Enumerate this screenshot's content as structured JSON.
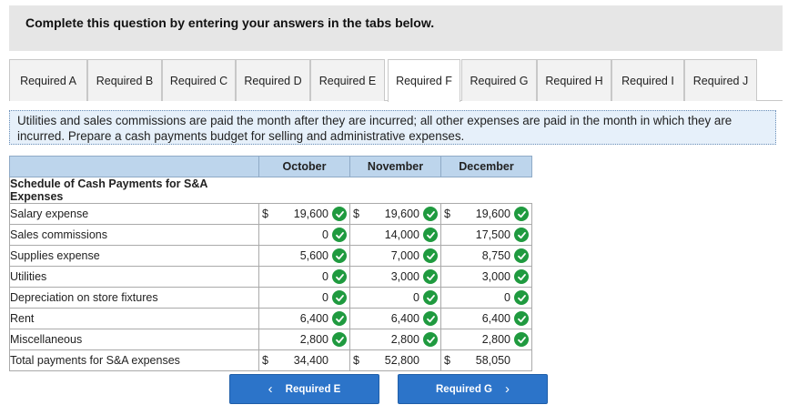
{
  "header": {
    "text": "Complete this question by entering your answers in the tabs below."
  },
  "tabs": [
    {
      "label": "Required A"
    },
    {
      "label": "Required B"
    },
    {
      "label": "Required C"
    },
    {
      "label": "Required D"
    },
    {
      "label": "Required E"
    },
    {
      "label": "Required F"
    },
    {
      "label": "Required G"
    },
    {
      "label": "Required H"
    },
    {
      "label": "Required I"
    },
    {
      "label": "Required J"
    }
  ],
  "active_tab": "Required F",
  "instructions": "Utilities and sales commissions are paid the month after they are incurred; all other expenses are paid in the month in which they are incurred. Prepare a cash payments budget for selling and administrative expenses.",
  "table": {
    "months": [
      "October",
      "November",
      "December"
    ],
    "title": "Schedule of Cash Payments for S&A Expenses",
    "rows": [
      {
        "label": "Salary expense",
        "values": [
          "19,600",
          "19,600",
          "19,600"
        ],
        "dollar": true,
        "checked": true
      },
      {
        "label": "Sales commissions",
        "values": [
          "0",
          "14,000",
          "17,500"
        ],
        "dollar": false,
        "checked": true
      },
      {
        "label": "Supplies expense",
        "values": [
          "5,600",
          "7,000",
          "8,750"
        ],
        "dollar": false,
        "checked": true
      },
      {
        "label": "Utilities",
        "values": [
          "0",
          "3,000",
          "3,000"
        ],
        "dollar": false,
        "checked": true
      },
      {
        "label": "Depreciation on store fixtures",
        "values": [
          "0",
          "0",
          "0"
        ],
        "dollar": false,
        "checked": true
      },
      {
        "label": "Rent",
        "values": [
          "6,400",
          "6,400",
          "6,400"
        ],
        "dollar": false,
        "checked": true
      },
      {
        "label": "Miscellaneous",
        "values": [
          "2,800",
          "2,800",
          "2,800"
        ],
        "dollar": false,
        "checked": true
      },
      {
        "label": "Total payments for S&A expenses",
        "values": [
          "34,400",
          "52,800",
          "58,050"
        ],
        "dollar": true,
        "checked": false
      }
    ],
    "currency_symbol": "$"
  },
  "nav": {
    "prev_label": "Required E",
    "next_label": "Required G",
    "prev_icon": "chevron-left-icon",
    "next_icon": "chevron-right-icon"
  },
  "colors": {
    "check": "#1f9a3f",
    "button": "#2c74c9",
    "table_header": "#bdd5ec",
    "instructions_bg": "#e6f0fa"
  }
}
